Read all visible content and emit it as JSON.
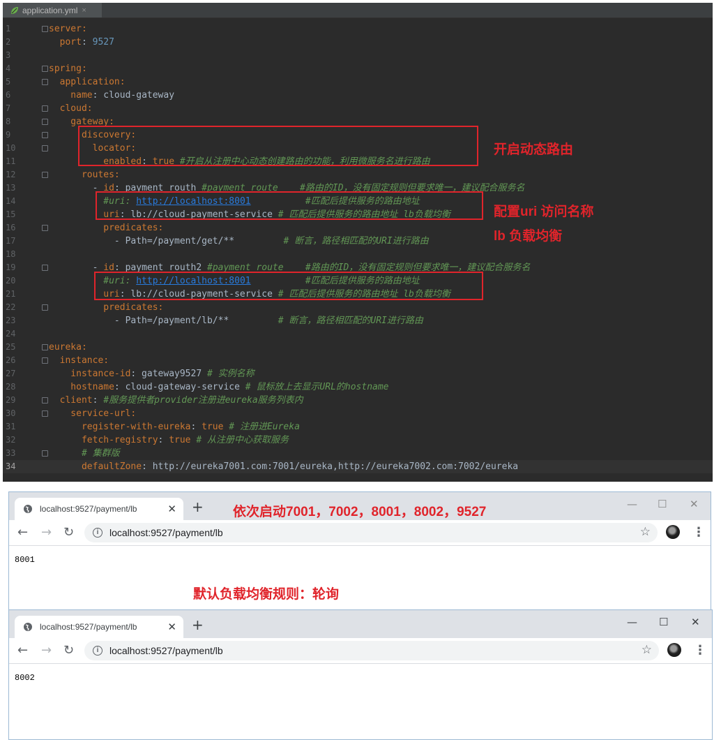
{
  "editor": {
    "tab_title": "application.yml",
    "tab_close": "×",
    "lines": [
      {
        "n": "1",
        "segs": [
          [
            "k",
            "server:"
          ]
        ]
      },
      {
        "n": "2",
        "segs": [
          [
            "k",
            "  port"
          ],
          [
            "v",
            ": "
          ],
          [
            "n",
            "9527"
          ]
        ]
      },
      {
        "n": "3",
        "segs": []
      },
      {
        "n": "4",
        "segs": [
          [
            "k",
            "spring:"
          ]
        ]
      },
      {
        "n": "5",
        "segs": [
          [
            "k",
            "  application:"
          ]
        ]
      },
      {
        "n": "6",
        "segs": [
          [
            "k",
            "    name"
          ],
          [
            "v",
            ": cloud-gateway"
          ]
        ]
      },
      {
        "n": "7",
        "segs": [
          [
            "k",
            "  cloud:"
          ]
        ]
      },
      {
        "n": "8",
        "segs": [
          [
            "k",
            "    gateway:"
          ]
        ]
      },
      {
        "n": "9",
        "segs": [
          [
            "k",
            "      discovery:"
          ]
        ]
      },
      {
        "n": "10",
        "segs": [
          [
            "k",
            "        locator:"
          ]
        ]
      },
      {
        "n": "11",
        "segs": [
          [
            "k",
            "          enabled"
          ],
          [
            "v",
            ": "
          ],
          [
            "k",
            "true "
          ],
          [
            "c",
            "#开启从注册中心动态创建路由的功能，利用微服务名进行路由"
          ]
        ]
      },
      {
        "n": "12",
        "segs": [
          [
            "k",
            "      routes:"
          ]
        ]
      },
      {
        "n": "13",
        "segs": [
          [
            "v",
            "        - "
          ],
          [
            "k",
            "id"
          ],
          [
            "v",
            ": payment_routh "
          ],
          [
            "c",
            "#payment_route    #路由的ID，没有固定规则但要求唯一，建议配合服务名"
          ]
        ]
      },
      {
        "n": "14",
        "segs": [
          [
            "c",
            "          #uri: "
          ],
          [
            "u",
            "http://localhost:8001"
          ],
          [
            "c",
            "          #匹配后提供服务的路由地址"
          ]
        ]
      },
      {
        "n": "15",
        "segs": [
          [
            "k",
            "          uri"
          ],
          [
            "v",
            ": lb://cloud-payment-service "
          ],
          [
            "c",
            "# 匹配后提供服务的路由地址 lb负载均衡"
          ]
        ]
      },
      {
        "n": "16",
        "segs": [
          [
            "k",
            "          predicates:"
          ]
        ]
      },
      {
        "n": "17",
        "segs": [
          [
            "v",
            "            - Path=/payment/get/**         "
          ],
          [
            "c",
            "# 断言，路径相匹配的URI进行路由"
          ]
        ]
      },
      {
        "n": "18",
        "segs": []
      },
      {
        "n": "19",
        "segs": [
          [
            "v",
            "        - "
          ],
          [
            "k",
            "id"
          ],
          [
            "v",
            ": payment_routh2 "
          ],
          [
            "c",
            "#payment_route    #路由的ID，没有固定规则但要求唯一，建议配合服务名"
          ]
        ]
      },
      {
        "n": "20",
        "segs": [
          [
            "c",
            "          #uri: "
          ],
          [
            "u",
            "http://localhost:8001"
          ],
          [
            "c",
            "          #匹配后提供服务的路由地址"
          ]
        ]
      },
      {
        "n": "21",
        "segs": [
          [
            "k",
            "          uri"
          ],
          [
            "v",
            ": lb://cloud-payment-service "
          ],
          [
            "c",
            "# 匹配后提供服务的路由地址 lb负载均衡"
          ]
        ]
      },
      {
        "n": "22",
        "segs": [
          [
            "k",
            "          predicates:"
          ]
        ]
      },
      {
        "n": "23",
        "segs": [
          [
            "v",
            "            - Path=/payment/lb/**         "
          ],
          [
            "c",
            "# 断言，路径相匹配的URI进行路由"
          ]
        ]
      },
      {
        "n": "24",
        "segs": []
      },
      {
        "n": "25",
        "segs": [
          [
            "k",
            "eureka:"
          ]
        ]
      },
      {
        "n": "26",
        "segs": [
          [
            "k",
            "  instance:"
          ]
        ]
      },
      {
        "n": "27",
        "segs": [
          [
            "k",
            "    instance-id"
          ],
          [
            "v",
            ": gateway9527 "
          ],
          [
            "c",
            "# 实例名称"
          ]
        ]
      },
      {
        "n": "28",
        "segs": [
          [
            "k",
            "    hostname"
          ],
          [
            "v",
            ": cloud-gateway-service "
          ],
          [
            "c",
            "# 鼠标放上去显示URL的hostname"
          ]
        ]
      },
      {
        "n": "29",
        "segs": [
          [
            "k",
            "  client"
          ],
          [
            "v",
            ": "
          ],
          [
            "c",
            "#服务提供者provider注册进eureka服务列表内"
          ]
        ]
      },
      {
        "n": "30",
        "segs": [
          [
            "k",
            "    service-url:"
          ]
        ]
      },
      {
        "n": "31",
        "segs": [
          [
            "k",
            "      register-with-eureka"
          ],
          [
            "v",
            ": "
          ],
          [
            "k",
            "true "
          ],
          [
            "c",
            "# 注册进Eureka"
          ]
        ]
      },
      {
        "n": "32",
        "segs": [
          [
            "k",
            "      fetch-registry"
          ],
          [
            "v",
            ": "
          ],
          [
            "k",
            "true "
          ],
          [
            "c",
            "# 从注册中心获取服务"
          ]
        ]
      },
      {
        "n": "33",
        "segs": [
          [
            "c",
            "      # 集群版"
          ]
        ]
      },
      {
        "n": "34",
        "segs": [
          [
            "k",
            "      defaultZone"
          ],
          [
            "v",
            ": http://eureka7001.com:7001/eureka,http://eureka7002.com:7002/eureka"
          ]
        ]
      }
    ]
  },
  "annotations": {
    "dynamic_routing": "开启动态路由",
    "config_uri": "配置uri 访问名称",
    "lb_balance": "lb 负载均衡",
    "startup_order": "依次启动7001，7002，8001，8002，9527",
    "default_rule": "默认负载均衡规则：轮询"
  },
  "browser1": {
    "tab_title": "localhost:9527/payment/lb",
    "url": "localhost:9527/payment/lb",
    "body": "8001"
  },
  "browser2": {
    "tab_title": "localhost:9527/payment/lb",
    "url": "localhost:9527/payment/lb",
    "body": "8002"
  },
  "glyphs": {
    "tab_close": "✕",
    "new_tab": "+",
    "minimize": "—",
    "maximize": "☐",
    "close": "✕",
    "back": "←",
    "forward": "→",
    "reload": "↻",
    "info": "i",
    "star": "☆",
    "menu": "⋮"
  },
  "colors": {
    "annotation_red": "#e0242b",
    "yaml_key": "#cc7832",
    "yaml_comment": "#629755",
    "yaml_number": "#6897bb",
    "editor_bg": "#2b2b2b"
  }
}
